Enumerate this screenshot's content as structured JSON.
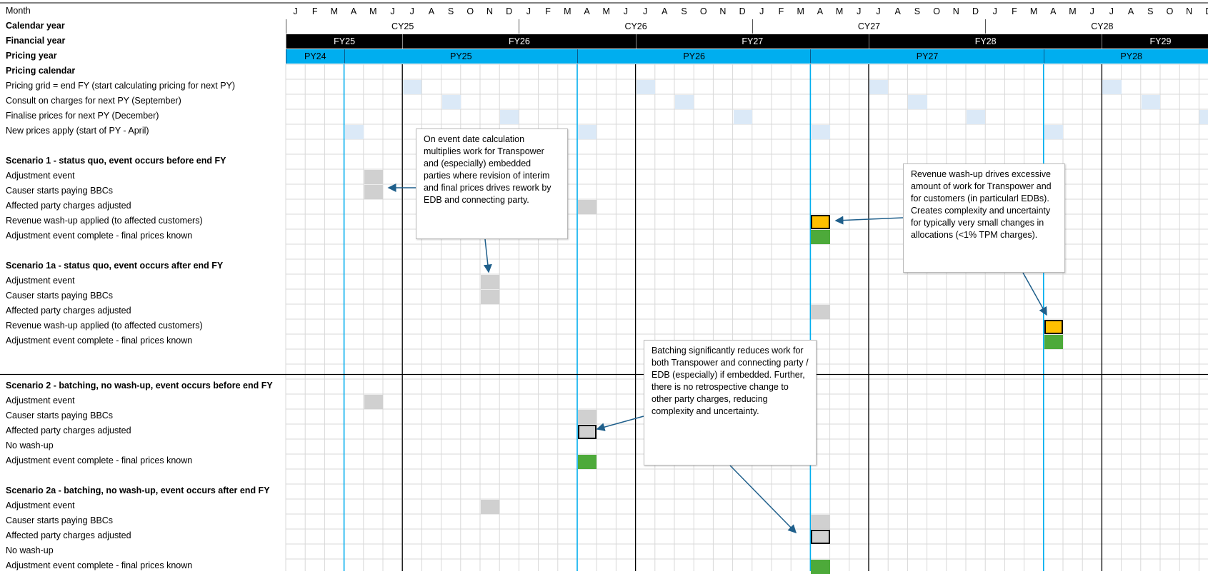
{
  "header_rows": {
    "month_label": "Month",
    "calendar_year_label": "Calendar year",
    "financial_year_label": "Financial year",
    "pricing_year_label": "Pricing year"
  },
  "months": [
    "J",
    "F",
    "M",
    "A",
    "M",
    "J",
    "J",
    "A",
    "S",
    "O",
    "N",
    "D",
    "J",
    "F",
    "M",
    "A",
    "M",
    "J",
    "J",
    "A",
    "S",
    "O",
    "N",
    "D",
    "J",
    "F",
    "M",
    "A",
    "M",
    "J",
    "J",
    "A",
    "S",
    "O",
    "N",
    "D",
    "J",
    "F",
    "M",
    "A",
    "M",
    "J",
    "J",
    "A",
    "S",
    "O",
    "N",
    "D"
  ],
  "calendar_years": [
    "CY25",
    "CY26",
    "CY27",
    "CY28"
  ],
  "financial_years": [
    "FY25",
    "FY26",
    "FY27",
    "FY28",
    "FY29"
  ],
  "pricing_years": [
    "PY24",
    "PY25",
    "PY26",
    "PY27",
    "PY28"
  ],
  "rows": [
    {
      "label": "Pricing calendar",
      "bold": true
    },
    {
      "label": "Pricing grid = end FY (start calculating pricing for next PY)",
      "bold": false
    },
    {
      "label": "Consult on charges for next PY (September)",
      "bold": false
    },
    {
      "label": "Finalise prices for next PY (December)",
      "bold": false
    },
    {
      "label": "New prices apply (start of PY - April)",
      "bold": false
    },
    {
      "label": "",
      "bold": false
    },
    {
      "label": "Scenario 1 - status quo, event occurs before end FY",
      "bold": true
    },
    {
      "label": "Adjustment event",
      "bold": false
    },
    {
      "label": "Causer starts paying BBCs",
      "bold": false
    },
    {
      "label": "Affected party charges adjusted",
      "bold": false
    },
    {
      "label": "Revenue wash-up applied (to affected customers)",
      "bold": false
    },
    {
      "label": "Adjustment event complete - final prices known",
      "bold": false
    },
    {
      "label": "",
      "bold": false
    },
    {
      "label": "Scenario 1a - status quo, event occurs after end FY",
      "bold": true
    },
    {
      "label": "Adjustment event",
      "bold": false
    },
    {
      "label": "Causer starts paying BBCs",
      "bold": false
    },
    {
      "label": "Affected party charges adjusted",
      "bold": false
    },
    {
      "label": "Revenue wash-up applied (to affected customers)",
      "bold": false
    },
    {
      "label": "Adjustment event complete - final prices known",
      "bold": false
    },
    {
      "label": "",
      "bold": false
    },
    {
      "label": "",
      "bold": false
    },
    {
      "label": "Scenario 2 - batching, no wash-up, event occurs before end FY",
      "bold": true
    },
    {
      "label": "Adjustment event",
      "bold": false
    },
    {
      "label": "Causer starts paying BBCs",
      "bold": false
    },
    {
      "label": "Affected party charges adjusted",
      "bold": false
    },
    {
      "label": "No wash-up",
      "bold": false
    },
    {
      "label": "Adjustment event complete - final prices known",
      "bold": false
    },
    {
      "label": "",
      "bold": false
    },
    {
      "label": "Scenario 2a - batching, no wash-up, event occurs after end FY",
      "bold": true
    },
    {
      "label": "Adjustment event",
      "bold": false
    },
    {
      "label": "Causer starts paying BBCs",
      "bold": false
    },
    {
      "label": "Affected party charges adjusted",
      "bold": false
    },
    {
      "label": "No wash-up",
      "bold": false
    },
    {
      "label": "Adjustment event complete - final prices known",
      "bold": false
    }
  ],
  "cells": [
    {
      "row": 1,
      "col": 6,
      "type": "lightblue"
    },
    {
      "row": 1,
      "col": 18,
      "type": "lightblue"
    },
    {
      "row": 1,
      "col": 30,
      "type": "lightblue"
    },
    {
      "row": 1,
      "col": 42,
      "type": "lightblue"
    },
    {
      "row": 2,
      "col": 8,
      "type": "lightblue"
    },
    {
      "row": 2,
      "col": 20,
      "type": "lightblue"
    },
    {
      "row": 2,
      "col": 32,
      "type": "lightblue"
    },
    {
      "row": 2,
      "col": 44,
      "type": "lightblue"
    },
    {
      "row": 3,
      "col": 11,
      "type": "lightblue"
    },
    {
      "row": 3,
      "col": 23,
      "type": "lightblue"
    },
    {
      "row": 3,
      "col": 35,
      "type": "lightblue"
    },
    {
      "row": 3,
      "col": 47,
      "type": "lightblue"
    },
    {
      "row": 4,
      "col": 3,
      "type": "lightblue"
    },
    {
      "row": 4,
      "col": 15,
      "type": "lightblue"
    },
    {
      "row": 4,
      "col": 27,
      "type": "lightblue"
    },
    {
      "row": 4,
      "col": 39,
      "type": "lightblue"
    },
    {
      "row": 7,
      "col": 4,
      "type": "grey"
    },
    {
      "row": 8,
      "col": 4,
      "type": "grey"
    },
    {
      "row": 9,
      "col": 15,
      "type": "grey"
    },
    {
      "row": 10,
      "col": 27,
      "type": "amber"
    },
    {
      "row": 11,
      "col": 27,
      "type": "green"
    },
    {
      "row": 14,
      "col": 10,
      "type": "grey"
    },
    {
      "row": 15,
      "col": 10,
      "type": "grey"
    },
    {
      "row": 16,
      "col": 27,
      "type": "grey"
    },
    {
      "row": 17,
      "col": 39,
      "type": "amber"
    },
    {
      "row": 18,
      "col": 39,
      "type": "green"
    },
    {
      "row": 22,
      "col": 4,
      "type": "grey"
    },
    {
      "row": 23,
      "col": 15,
      "type": "grey"
    },
    {
      "row": 24,
      "col": 15,
      "type": "greybox"
    },
    {
      "row": 26,
      "col": 15,
      "type": "green"
    },
    {
      "row": 29,
      "col": 10,
      "type": "grey"
    },
    {
      "row": 30,
      "col": 27,
      "type": "grey"
    },
    {
      "row": 31,
      "col": 27,
      "type": "greybox"
    },
    {
      "row": 33,
      "col": 27,
      "type": "green"
    }
  ],
  "callouts": {
    "callout1": "On event date calculation multiplies work for Transpower and (especially) embedded parties where revision of interim and final prices drives rework by EDB and connecting party.",
    "callout2": "Revenue wash-up drives excessive amount of work for Transpower and for customers (in particularl EDBs). Creates complexity and uncertainty for typically very small changes in allocations (<1% TPM charges).",
    "callout3": "Batching significantly reduces work for both Transpower and connecting party / EDB (especially) if embedded. Further, there is no retrospective change to other party charges, reducing complexity and uncertainty."
  },
  "colors": {
    "pricing_year_fill": "#00aeef",
    "financial_year_fill": "#000000",
    "amber": "#ffc000",
    "green": "#4daa3a",
    "grey": "#d0d0d0",
    "light_blue": "#dbe9f7",
    "arrow": "#1f5f8b"
  }
}
